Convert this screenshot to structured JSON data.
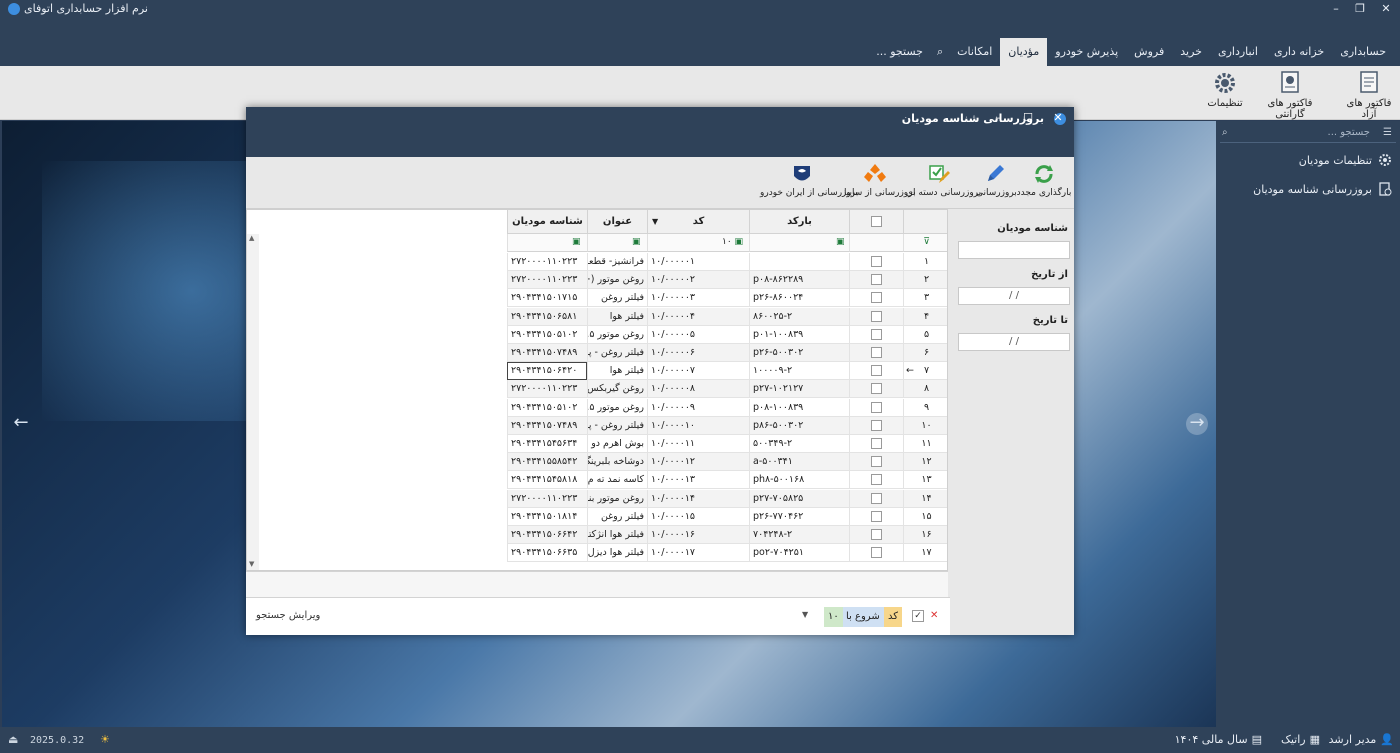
{
  "app": {
    "title": "نرم افزار حسابداری اتوفای"
  },
  "menu": {
    "items": [
      "حسابداری",
      "خزانه داری",
      "انبارداری",
      "خرید",
      "فروش",
      "پذیرش خودرو",
      "مؤدیان",
      "امکانات"
    ],
    "search_placeholder": "جستجو ..."
  },
  "ribbon": {
    "items": [
      "فاکتور های آزاد",
      "فاکتور های گارانتی",
      "تنظیمات"
    ]
  },
  "sidepanel": {
    "search_placeholder": "جستجو ...",
    "items": [
      "تنظیمات مودیان",
      "بروزرسانی شناسه مودیان"
    ]
  },
  "dialog": {
    "title": "بروزرسانی شناسه مودیان",
    "toolbar": [
      "بارگذاری مجدد",
      "بروزرسانی",
      "بروزرسانی دسته ای",
      "بروزرسانی از سایپا",
      "بروزرسانی از ایران خودرو"
    ],
    "filters": {
      "taxpayer_id_label": "شناسه مودیان",
      "from_date_label": "از تاریخ",
      "to_date_label": "تا تاریخ",
      "date_placeholder": "/      /"
    },
    "columns": [
      "بارکد",
      "کد",
      "عنوان",
      "شناسه مودیان"
    ],
    "filter_row": {
      "code_filter": "۱۰"
    },
    "rows": [
      {
        "n": "۱",
        "barcode": "",
        "code": "۱۰/۰۰۰۰۰۱",
        "title": "فرانشیز- قطعه",
        "tax": "۲۷۲۰۰۰۰۱۱۰۲۲۳"
      },
      {
        "n": "۲",
        "barcode": "p۰۸-۸۶۲۲۸۹",
        "code": "۱۰/۰۰۰۰۰۲",
        "title": "روغن موتور (+",
        "tax": "۲۷۲۰۰۰۰۱۱۰۲۲۳"
      },
      {
        "n": "۳",
        "barcode": "p۲۶-۸۶۰۰۲۴",
        "code": "۱۰/۰۰۰۰۰۳",
        "title": "فیلتر روغن",
        "tax": "۲۹۰۴۳۴۱۵۰۱۷۱۵"
      },
      {
        "n": "۴",
        "barcode": "۸۶۰۰۲۵-۲",
        "code": "۱۰/۰۰۰۰۰۴",
        "title": "فیلتر هوا",
        "tax": "۲۹۰۴۳۴۱۵۰۶۵۸۱"
      },
      {
        "n": "۵",
        "barcode": "p۰۱-۱۰۰۸۳۹",
        "code": "۱۰/۰۰۰۰۰۵",
        "title": "روغن موتور ۵.",
        "tax": "۲۹۰۴۳۴۱۵۰۵۱۰۲"
      },
      {
        "n": "۶",
        "barcode": "p۲۶-۵۰۰۳۰۲",
        "code": "۱۰/۰۰۰۰۰۶",
        "title": "فیلتر روغن - پر",
        "tax": "۲۹۰۴۳۴۱۵۰۷۴۸۹"
      },
      {
        "n": "۷",
        "barcode": "۱۰۰۰۰۹-۲",
        "code": "۱۰/۰۰۰۰۰۷",
        "title": "فیلتر هوا",
        "tax": "۲۹۰۴۳۴۱۵۰۶۴۲۰"
      },
      {
        "n": "۸",
        "barcode": "p۲۷-۱۰۲۱۲۷",
        "code": "۱۰/۰۰۰۰۰۸",
        "title": "روغن گیربکس",
        "tax": "۲۷۲۰۰۰۰۱۱۰۲۲۳"
      },
      {
        "n": "۹",
        "barcode": "p۰۸-۱۰۰۸۳۹",
        "code": "۱۰/۰۰۰۰۰۹",
        "title": "روغن موتور ۵.",
        "tax": "۲۹۰۴۳۴۱۵۰۵۱۰۲"
      },
      {
        "n": "۱۰",
        "barcode": "p۸۶-۵۰۰۳۰۲",
        "code": "۱۰/۰۰۰۰۱۰",
        "title": "فیلتر روغن - پر",
        "tax": "۲۹۰۴۳۴۱۵۰۷۴۸۹"
      },
      {
        "n": "۱۱",
        "barcode": "۵۰۰۳۴۹-۲",
        "code": "۱۰/۰۰۰۰۱۱",
        "title": "بوش اهرم دو",
        "tax": "۲۹۰۴۳۴۱۵۴۵۶۳۴"
      },
      {
        "n": "۱۲",
        "barcode": "a-۵۰۰۳۴۱",
        "code": "۱۰/۰۰۰۰۱۲",
        "title": "دوشاخه بلبرینگ",
        "tax": "۲۹۰۴۳۴۱۵۵۸۵۴۲"
      },
      {
        "n": "۱۳",
        "barcode": "ph۸-۵۰۰۱۶۸",
        "code": "۱۰/۰۰۰۰۱۳",
        "title": "کاسه نمد ته م",
        "tax": "۲۹۰۴۳۴۱۵۴۵۸۱۸"
      },
      {
        "n": "۱۴",
        "barcode": "p۲۷-۷۰۵۸۲۵",
        "code": "۱۰/۰۰۰۰۱۴",
        "title": "روغن موتور بنز",
        "tax": "۲۷۲۰۰۰۰۱۱۰۲۲۳"
      },
      {
        "n": "۱۵",
        "barcode": "p۲۶-۷۷۰۴۶۲",
        "code": "۱۰/۰۰۰۰۱۵",
        "title": "فیلتر روغن",
        "tax": "۲۹۰۴۳۴۱۵۰۱۸۱۴"
      },
      {
        "n": "۱۶",
        "barcode": "۷۰۴۲۴۸-۲",
        "code": "۱۰/۰۰۰۰۱۶",
        "title": "فیلتر هوا انژکتو",
        "tax": "۲۹۰۴۳۴۱۵۰۶۶۴۲"
      },
      {
        "n": "۱۷",
        "barcode": "po۲-۷۰۴۲۵۱",
        "code": "۱۰/۰۰۰۰۱۷",
        "title": "فیلتر هوا دیزل",
        "tax": "۲۹۰۴۳۴۱۵۰۶۶۳۵"
      }
    ],
    "selected_row_marker": "←",
    "bottom": {
      "chip_code": "کد",
      "chip_starts": "شروع با",
      "chip_value": "۱۰",
      "edit_search": "ویرایش جستجو"
    }
  },
  "status": {
    "user": "مدیر ارشد",
    "company": "راتیک",
    "fiscal_year": "سال مالی ۱۴۰۴",
    "version": "2025.0.32"
  },
  "colors": {
    "chrome": "#2f4259",
    "panel": "#e8e8e8",
    "accent": "#3d8ee0"
  }
}
